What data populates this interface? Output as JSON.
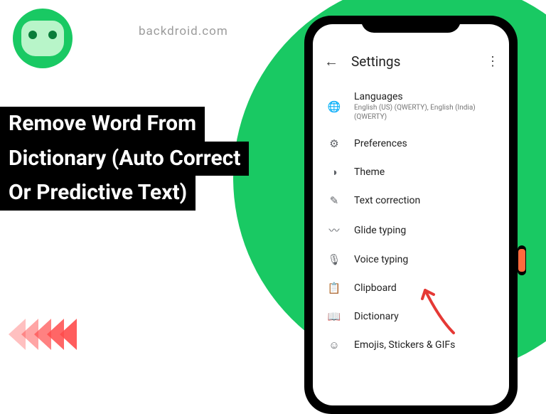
{
  "site": {
    "name": "backdroid.com"
  },
  "headline": {
    "line1": "Remove Word From",
    "line2": "Dictionary (Auto Correct",
    "line3": "Or Predictive Text)"
  },
  "phone": {
    "title": "Settings",
    "items": [
      {
        "icon": "🌐",
        "label": "Languages",
        "sub": "English (US) (QWERTY), English (India) (QWERTY)"
      },
      {
        "icon": "⚙",
        "label": "Preferences",
        "sub": ""
      },
      {
        "icon": "◑",
        "label": "Theme",
        "sub": ""
      },
      {
        "icon": "✎",
        "label": "Text correction",
        "sub": ""
      },
      {
        "icon": "〰",
        "label": "Glide typing",
        "sub": ""
      },
      {
        "icon": "🎙",
        "label": "Voice typing",
        "sub": ""
      },
      {
        "icon": "📋",
        "label": "Clipboard",
        "sub": ""
      },
      {
        "icon": "📖",
        "label": "Dictionary",
        "sub": ""
      },
      {
        "icon": "☺",
        "label": "Emojis, Stickers & GIFs",
        "sub": ""
      }
    ]
  }
}
